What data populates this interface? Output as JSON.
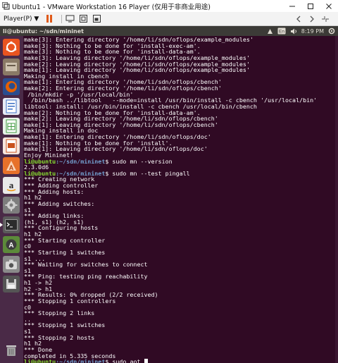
{
  "vmware": {
    "title": "Ubuntu1 - VMware Workstation 16 Player (仅用于非商业用途)",
    "player_menu": "Player(P) ▼",
    "toolbar_icons": [
      "pause-icon",
      "send-ctrl-alt-del-icon",
      "fullscreen-icon",
      "unity-icon"
    ],
    "toolbar_right_icons": [
      "back-icon",
      "forward-icon",
      "collapse-icon"
    ],
    "window_controls": [
      "minimize",
      "maximize",
      "close"
    ]
  },
  "ubuntu_panel": {
    "title": "li@ubuntu: ~/sdn/mininet",
    "clock": "8:19 PM",
    "indicators": [
      "network-icon",
      "keyboard-en-icon",
      "volume-icon",
      "power-gear-icon"
    ],
    "keyboard_label": "En"
  },
  "launcher": {
    "items": [
      {
        "name": "ubuntu-dash",
        "color": "#e95420"
      },
      {
        "name": "files",
        "color": "#8a7a66"
      },
      {
        "name": "firefox",
        "color": "#e66000"
      },
      {
        "name": "libreoffice-writer",
        "color": "#3a6fc4"
      },
      {
        "name": "libreoffice-calc",
        "color": "#3f9a3f"
      },
      {
        "name": "libreoffice-impress",
        "color": "#c9531e"
      },
      {
        "name": "ubuntu-software",
        "color": "#e7712a"
      },
      {
        "name": "amazon",
        "color": "#e9e9e9"
      },
      {
        "name": "system-settings",
        "color": "#9a9a9a"
      },
      {
        "name": "terminal",
        "color": "#2c2c2c"
      },
      {
        "name": "software-updater",
        "color": "#5c8a3a"
      },
      {
        "name": "screenshot",
        "color": "#7c7c7c"
      },
      {
        "name": "floppy",
        "color": "#444444"
      },
      {
        "name": "trash",
        "color": "#6c6c6c"
      }
    ]
  },
  "terminal": {
    "user_host": "li@ubuntu",
    "path": ":~/sdn/mininet",
    "prompt_symbol": "$",
    "lines": [
      {
        "type": "out",
        "text": "make[3]: Entering directory '/home/li/sdn/oflops/example_modules'"
      },
      {
        "type": "out",
        "text": "make[3]: Nothing to be done for 'install-exec-am'."
      },
      {
        "type": "out",
        "text": "make[3]: Nothing to be done for 'install-data-am'."
      },
      {
        "type": "out",
        "text": "make[3]: Leaving directory '/home/li/sdn/oflops/example_modules'"
      },
      {
        "type": "out",
        "text": "make[2]: Leaving directory '/home/li/sdn/oflops/example_modules'"
      },
      {
        "type": "out",
        "text": "make[1]: Leaving directory '/home/li/sdn/oflops/example_modules'"
      },
      {
        "type": "out",
        "text": "Making install in cbench"
      },
      {
        "type": "out",
        "text": "make[1]: Entering directory '/home/li/sdn/oflops/cbench'"
      },
      {
        "type": "out",
        "text": "make[2]: Entering directory '/home/li/sdn/oflops/cbench'"
      },
      {
        "type": "out",
        "text": " /bin/mkdir -p '/usr/local/bin'"
      },
      {
        "type": "out",
        "text": "  /bin/bash ../libtool   --mode=install /usr/bin/install -c cbench '/usr/local/bin'"
      },
      {
        "type": "out",
        "text": "libtool: install: /usr/bin/install -c cbench /usr/local/bin/cbench"
      },
      {
        "type": "out",
        "text": "make[2]: Nothing to be done for 'install-data-am'."
      },
      {
        "type": "out",
        "text": "make[2]: Leaving directory '/home/li/sdn/oflops/cbench'"
      },
      {
        "type": "out",
        "text": "make[1]: Leaving directory '/home/li/sdn/oflops/cbench'"
      },
      {
        "type": "out",
        "text": "Making install in doc"
      },
      {
        "type": "out",
        "text": "make[1]: Entering directory '/home/li/sdn/oflops/doc'"
      },
      {
        "type": "out",
        "text": "make[1]: Nothing to be done for 'install'."
      },
      {
        "type": "out",
        "text": "make[1]: Leaving directory '/home/li/sdn/oflops/doc'"
      },
      {
        "type": "out",
        "text": "Enjoy Mininet!"
      },
      {
        "type": "cmd",
        "text": " sudo mn --version"
      },
      {
        "type": "out",
        "text": "2.3.0d6"
      },
      {
        "type": "cmd",
        "text": " sudo mn --test pingall"
      },
      {
        "type": "out",
        "text": "*** Creating network"
      },
      {
        "type": "out",
        "text": "*** Adding controller"
      },
      {
        "type": "out",
        "text": "*** Adding hosts:"
      },
      {
        "type": "out",
        "text": "h1 h2"
      },
      {
        "type": "out",
        "text": "*** Adding switches:"
      },
      {
        "type": "out",
        "text": "s1"
      },
      {
        "type": "out",
        "text": "*** Adding links:"
      },
      {
        "type": "out",
        "text": "(h1, s1) (h2, s1)"
      },
      {
        "type": "out",
        "text": "*** Configuring hosts"
      },
      {
        "type": "out",
        "text": "h1 h2"
      },
      {
        "type": "out",
        "text": "*** Starting controller"
      },
      {
        "type": "out",
        "text": "c0"
      },
      {
        "type": "out",
        "text": "*** Starting 1 switches"
      },
      {
        "type": "out",
        "text": "s1 ..."
      },
      {
        "type": "out",
        "text": "*** Waiting for switches to connect"
      },
      {
        "type": "out",
        "text": "s1"
      },
      {
        "type": "out",
        "text": "*** Ping: testing ping reachability"
      },
      {
        "type": "out",
        "text": "h1 -> h2"
      },
      {
        "type": "out",
        "text": "h2 -> h1"
      },
      {
        "type": "out",
        "text": "*** Results: 0% dropped (2/2 received)"
      },
      {
        "type": "out",
        "text": "*** Stopping 1 controllers"
      },
      {
        "type": "out",
        "text": "c0"
      },
      {
        "type": "out",
        "text": "*** Stopping 2 links"
      },
      {
        "type": "out",
        "text": ".."
      },
      {
        "type": "out",
        "text": "*** Stopping 1 switches"
      },
      {
        "type": "out",
        "text": "s1"
      },
      {
        "type": "out",
        "text": "*** Stopping 2 hosts"
      },
      {
        "type": "out",
        "text": "h1 h2"
      },
      {
        "type": "out",
        "text": "*** Done"
      },
      {
        "type": "out",
        "text": "completed in 5.335 seconds"
      },
      {
        "type": "cmd",
        "text": " sudo aot",
        "cursor": true
      }
    ]
  }
}
